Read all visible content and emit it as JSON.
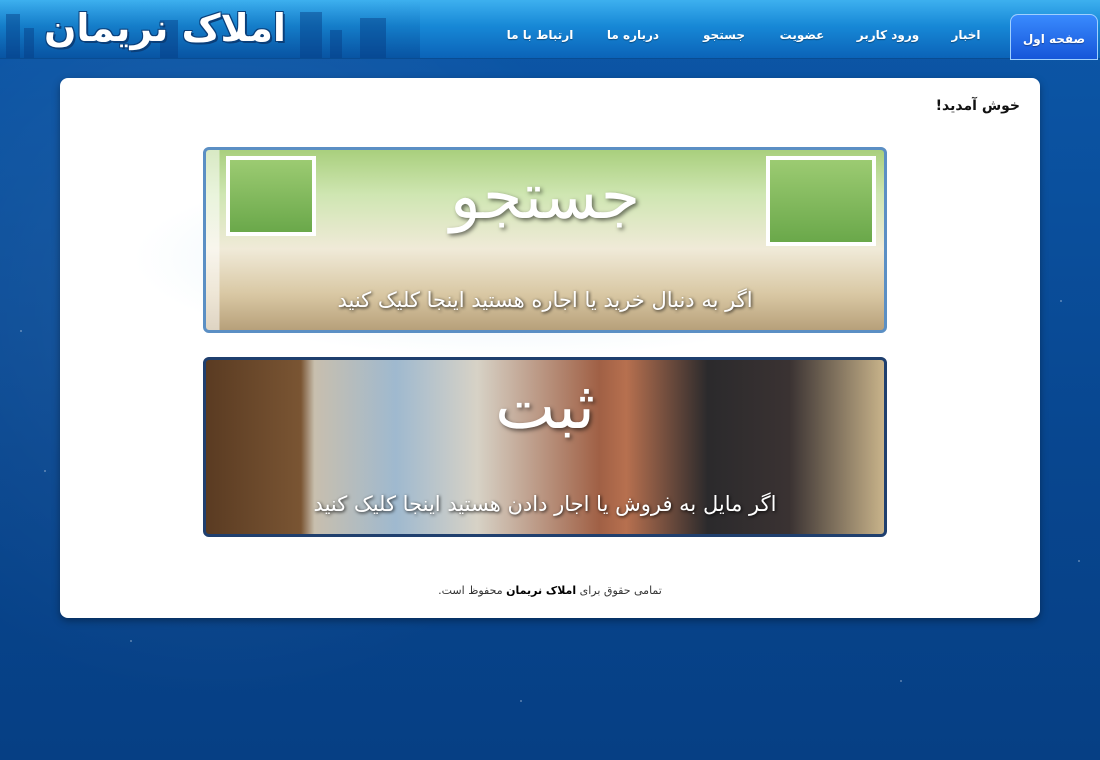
{
  "site": {
    "logo": "املاک نریمان"
  },
  "nav": {
    "items": [
      {
        "label": "صفحه اول",
        "active": true
      },
      {
        "label": "اخبار"
      },
      {
        "label": "ورود کاربر"
      },
      {
        "label": "عضویت"
      },
      {
        "label": "جستجو"
      },
      {
        "label": "درباره ما"
      },
      {
        "label": "ارتباط با ما"
      }
    ]
  },
  "main": {
    "welcome": "خوش آمدید!",
    "banners": {
      "search": {
        "title": "جستجو",
        "caption": "اگر به دنبال خرید یا اجاره هستید اینجا کلیک کنید"
      },
      "register": {
        "title": "ثبت",
        "caption": "اگر مایل به فروش یا اجار دادن هستید اینجا کلیک کنید"
      }
    }
  },
  "footer": {
    "prefix": "تمامی حقوق برای",
    "brand": "املاک نریمان",
    "suffix": "محفوظ است."
  },
  "colors": {
    "page_bg": "#0a4b98",
    "header": "#1788d6",
    "active_tab": "#1554d8",
    "content_bg": "#ffffff"
  }
}
